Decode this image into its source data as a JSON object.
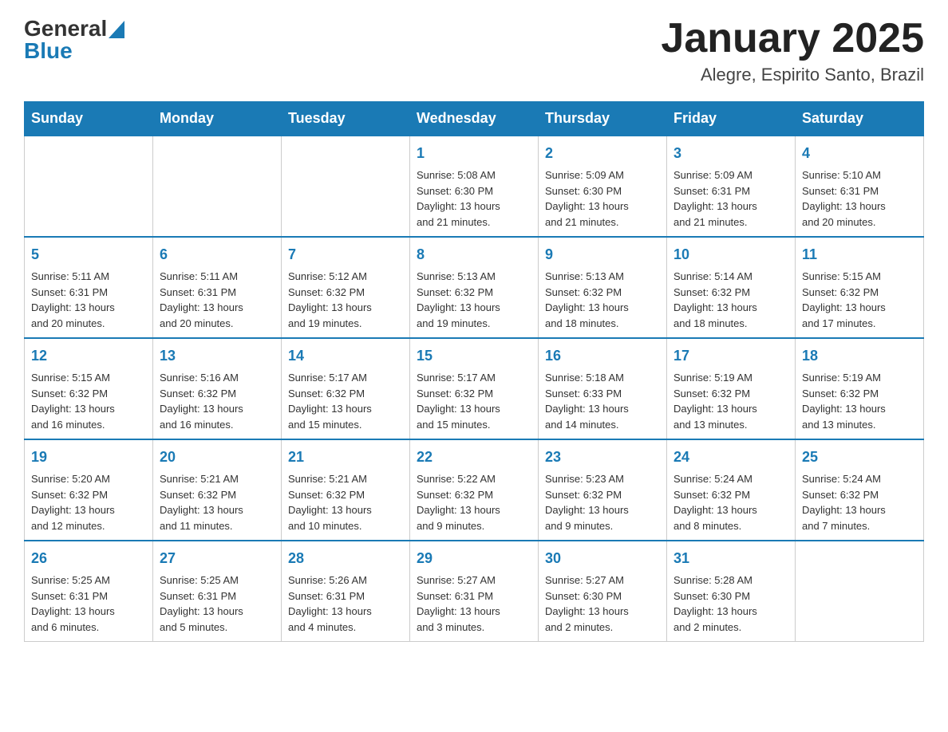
{
  "header": {
    "logo": {
      "general": "General",
      "blue": "Blue"
    },
    "title": "January 2025",
    "subtitle": "Alegre, Espirito Santo, Brazil"
  },
  "weekdays": [
    "Sunday",
    "Monday",
    "Tuesday",
    "Wednesday",
    "Thursday",
    "Friday",
    "Saturday"
  ],
  "weeks": [
    [
      {
        "day": "",
        "info": ""
      },
      {
        "day": "",
        "info": ""
      },
      {
        "day": "",
        "info": ""
      },
      {
        "day": "1",
        "info": "Sunrise: 5:08 AM\nSunset: 6:30 PM\nDaylight: 13 hours\nand 21 minutes."
      },
      {
        "day": "2",
        "info": "Sunrise: 5:09 AM\nSunset: 6:30 PM\nDaylight: 13 hours\nand 21 minutes."
      },
      {
        "day": "3",
        "info": "Sunrise: 5:09 AM\nSunset: 6:31 PM\nDaylight: 13 hours\nand 21 minutes."
      },
      {
        "day": "4",
        "info": "Sunrise: 5:10 AM\nSunset: 6:31 PM\nDaylight: 13 hours\nand 20 minutes."
      }
    ],
    [
      {
        "day": "5",
        "info": "Sunrise: 5:11 AM\nSunset: 6:31 PM\nDaylight: 13 hours\nand 20 minutes."
      },
      {
        "day": "6",
        "info": "Sunrise: 5:11 AM\nSunset: 6:31 PM\nDaylight: 13 hours\nand 20 minutes."
      },
      {
        "day": "7",
        "info": "Sunrise: 5:12 AM\nSunset: 6:32 PM\nDaylight: 13 hours\nand 19 minutes."
      },
      {
        "day": "8",
        "info": "Sunrise: 5:13 AM\nSunset: 6:32 PM\nDaylight: 13 hours\nand 19 minutes."
      },
      {
        "day": "9",
        "info": "Sunrise: 5:13 AM\nSunset: 6:32 PM\nDaylight: 13 hours\nand 18 minutes."
      },
      {
        "day": "10",
        "info": "Sunrise: 5:14 AM\nSunset: 6:32 PM\nDaylight: 13 hours\nand 18 minutes."
      },
      {
        "day": "11",
        "info": "Sunrise: 5:15 AM\nSunset: 6:32 PM\nDaylight: 13 hours\nand 17 minutes."
      }
    ],
    [
      {
        "day": "12",
        "info": "Sunrise: 5:15 AM\nSunset: 6:32 PM\nDaylight: 13 hours\nand 16 minutes."
      },
      {
        "day": "13",
        "info": "Sunrise: 5:16 AM\nSunset: 6:32 PM\nDaylight: 13 hours\nand 16 minutes."
      },
      {
        "day": "14",
        "info": "Sunrise: 5:17 AM\nSunset: 6:32 PM\nDaylight: 13 hours\nand 15 minutes."
      },
      {
        "day": "15",
        "info": "Sunrise: 5:17 AM\nSunset: 6:32 PM\nDaylight: 13 hours\nand 15 minutes."
      },
      {
        "day": "16",
        "info": "Sunrise: 5:18 AM\nSunset: 6:33 PM\nDaylight: 13 hours\nand 14 minutes."
      },
      {
        "day": "17",
        "info": "Sunrise: 5:19 AM\nSunset: 6:32 PM\nDaylight: 13 hours\nand 13 minutes."
      },
      {
        "day": "18",
        "info": "Sunrise: 5:19 AM\nSunset: 6:32 PM\nDaylight: 13 hours\nand 13 minutes."
      }
    ],
    [
      {
        "day": "19",
        "info": "Sunrise: 5:20 AM\nSunset: 6:32 PM\nDaylight: 13 hours\nand 12 minutes."
      },
      {
        "day": "20",
        "info": "Sunrise: 5:21 AM\nSunset: 6:32 PM\nDaylight: 13 hours\nand 11 minutes."
      },
      {
        "day": "21",
        "info": "Sunrise: 5:21 AM\nSunset: 6:32 PM\nDaylight: 13 hours\nand 10 minutes."
      },
      {
        "day": "22",
        "info": "Sunrise: 5:22 AM\nSunset: 6:32 PM\nDaylight: 13 hours\nand 9 minutes."
      },
      {
        "day": "23",
        "info": "Sunrise: 5:23 AM\nSunset: 6:32 PM\nDaylight: 13 hours\nand 9 minutes."
      },
      {
        "day": "24",
        "info": "Sunrise: 5:24 AM\nSunset: 6:32 PM\nDaylight: 13 hours\nand 8 minutes."
      },
      {
        "day": "25",
        "info": "Sunrise: 5:24 AM\nSunset: 6:32 PM\nDaylight: 13 hours\nand 7 minutes."
      }
    ],
    [
      {
        "day": "26",
        "info": "Sunrise: 5:25 AM\nSunset: 6:31 PM\nDaylight: 13 hours\nand 6 minutes."
      },
      {
        "day": "27",
        "info": "Sunrise: 5:25 AM\nSunset: 6:31 PM\nDaylight: 13 hours\nand 5 minutes."
      },
      {
        "day": "28",
        "info": "Sunrise: 5:26 AM\nSunset: 6:31 PM\nDaylight: 13 hours\nand 4 minutes."
      },
      {
        "day": "29",
        "info": "Sunrise: 5:27 AM\nSunset: 6:31 PM\nDaylight: 13 hours\nand 3 minutes."
      },
      {
        "day": "30",
        "info": "Sunrise: 5:27 AM\nSunset: 6:30 PM\nDaylight: 13 hours\nand 2 minutes."
      },
      {
        "day": "31",
        "info": "Sunrise: 5:28 AM\nSunset: 6:30 PM\nDaylight: 13 hours\nand 2 minutes."
      },
      {
        "day": "",
        "info": ""
      }
    ]
  ]
}
